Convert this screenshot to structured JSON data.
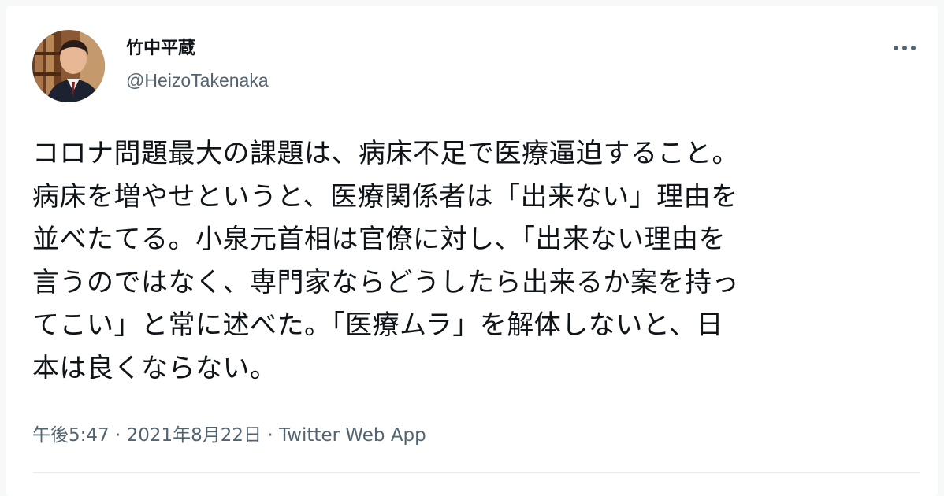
{
  "author": {
    "display_name": "竹中平蔵",
    "handle": "@HeizoTakenaka"
  },
  "tweet": {
    "text": "コロナ問題最大の課題は、病床不足で医療逼迫すること。\n病床を増やせというと、医療関係者は「出来ない」理由を\n並べたてる。小泉元首相は官僚に対し、「出来ない理由を\n言うのではなく、専門家ならどうしたら出来るか案を持っ\nてこい」と常に述べた。「医療ムラ」を解体しないと、日\n本は良くならない。"
  },
  "meta": {
    "time": "午後5:47",
    "sep1": " · ",
    "date": "2021年8月22日",
    "sep2": " · ",
    "source": "Twitter Web App"
  },
  "icons": {
    "more": "more-horizontal-icon"
  },
  "colors": {
    "text_primary": "#0f1419",
    "text_secondary": "#536471",
    "divider": "#e6ecf0"
  }
}
